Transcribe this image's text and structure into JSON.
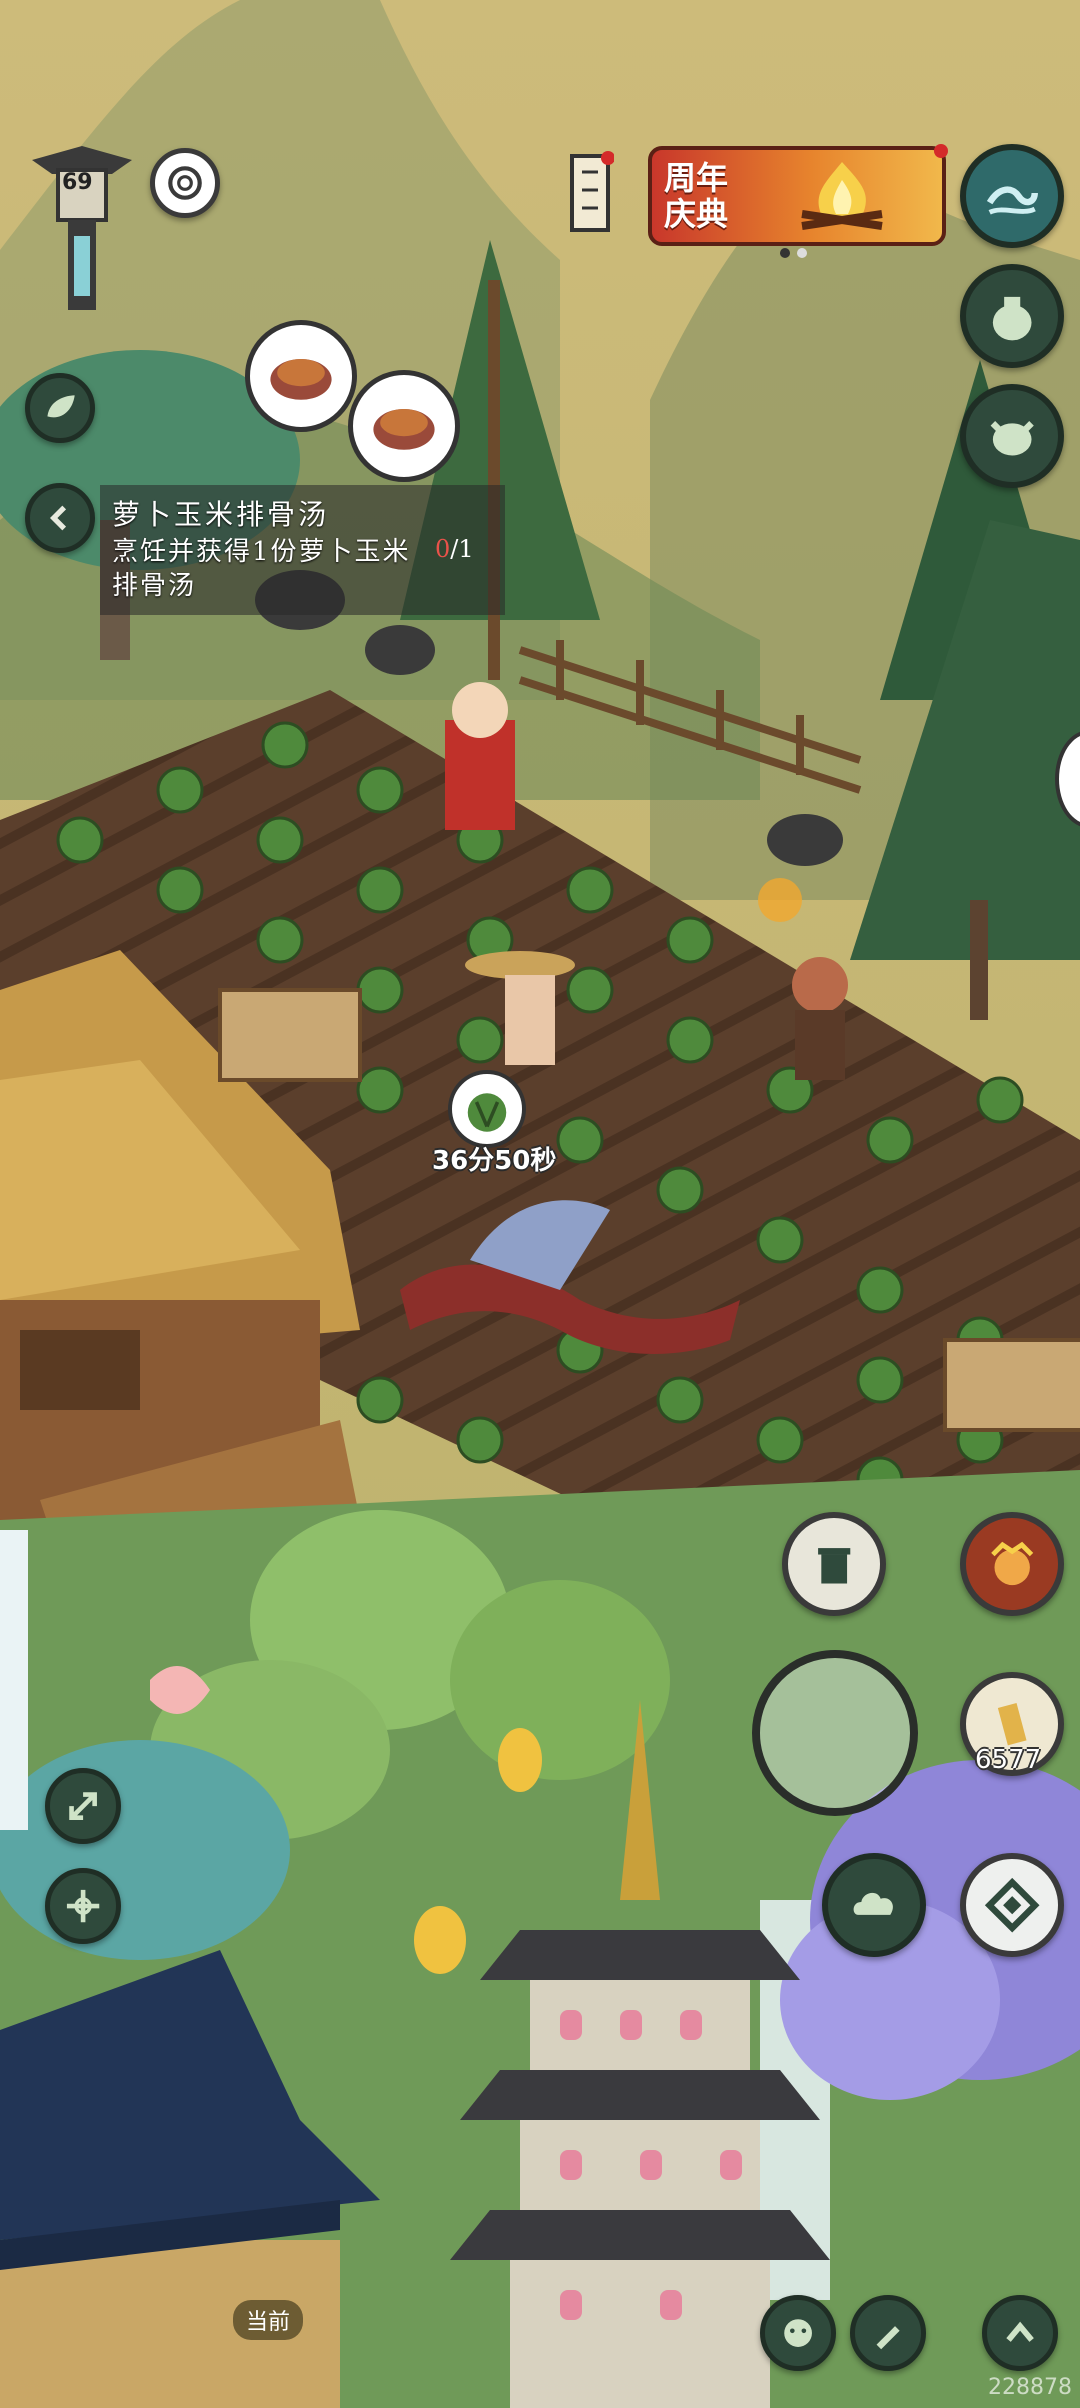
{
  "level": "69",
  "event_banner": {
    "title": "周年庆典"
  },
  "quest": {
    "title": "萝卜玉米排骨汤",
    "description": "烹饪并获得1份萝卜玉米排骨汤",
    "progress_current": "0",
    "progress_total": "/1"
  },
  "crop_timer": "36分50秒",
  "coin_count": "6577",
  "current_label": "当前",
  "watermark": "228878",
  "colors": {
    "ui_button_fill": "#2f4a3c",
    "ui_button_ring": "#1f2e25",
    "banner_red": "#c8372b"
  }
}
